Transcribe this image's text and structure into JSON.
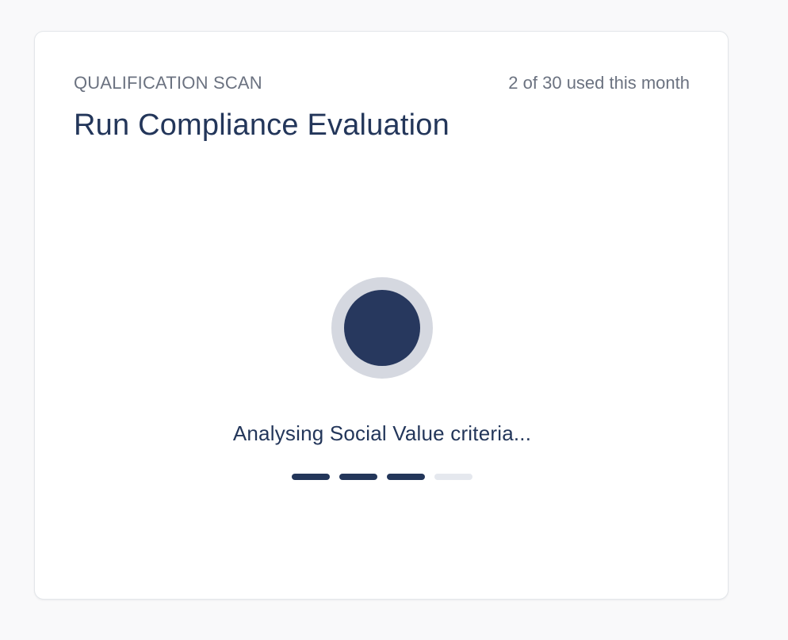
{
  "card": {
    "eyebrow": "QUALIFICATION SCAN",
    "usage": "2 of 30 used this month",
    "title": "Run Compliance Evaluation"
  },
  "progress": {
    "status_text": "Analysing Social Value criteria...",
    "steps_total": 4,
    "steps_completed": 3,
    "spinner_icon": "loading-spinner-icon"
  },
  "colors": {
    "primary": "#23365a",
    "muted_text": "#6b7280",
    "spinner_ring": "#d5d8e0",
    "step_inactive": "#e5e8ee"
  }
}
